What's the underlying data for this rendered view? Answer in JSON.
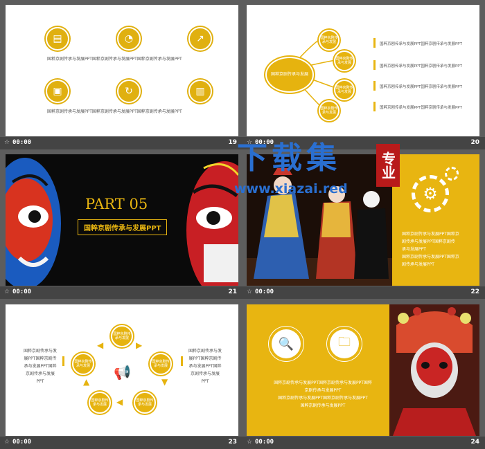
{
  "slides": [
    {
      "num": "19",
      "time": "00:00",
      "caption1": "国粹京剧传承与发展PPT国粹京剧传承与发展PPT国粹京剧传承与发展PPT",
      "caption2": "国粹京剧传承与发展PPT国粹京剧传承与发展PPT国粹京剧传承与发展PPT"
    },
    {
      "num": "20",
      "time": "00:00",
      "center": "国粹京剧传承与发展",
      "nodes": [
        "国粹京剧传承与发展",
        "国粹京剧传承与发展",
        "国粹京剧传承与发展",
        "国粹京剧传承与发展"
      ],
      "items": [
        "国粹京剧传承与发展PPT国粹京剧传承与发展PPT",
        "国粹京剧传承与发展PPT国粹京剧传承与发展PPT",
        "国粹京剧传承与发展PPT国粹京剧传承与发展PPT",
        "国粹京剧传承与发展PPT国粹京剧传承与发展PPT"
      ]
    },
    {
      "num": "21",
      "time": "00:00",
      "part": "PART 05",
      "subtitle": "国粹京剧传承与发展PPT"
    },
    {
      "num": "22",
      "time": "00:00",
      "text": [
        "国粹京剧传承与发展PPT国粹京",
        "剧传承与发展PPT国粹京剧传",
        "承与发展PPT",
        "国粹京剧传承与发展PPT国粹京",
        "剧传承与发展PPT"
      ]
    },
    {
      "num": "23",
      "time": "00:00",
      "left": [
        "国粹京剧传承与发",
        "展PPT国粹京剧传",
        "承与发展PPT国粹",
        "京剧传承与发展",
        "PPT"
      ],
      "right": [
        "国粹京剧传承与发",
        "展PPT国粹京剧传",
        "承与发展PPT国粹",
        "京剧传承与发展",
        "PPT"
      ],
      "cycle": [
        "国粹京剧传承与发展",
        "国粹京剧传承与发展",
        "国粹京剧传承与发展",
        "国粹京剧传承与发展",
        "国粹京剧传承与发展"
      ]
    },
    {
      "num": "24",
      "time": "00:00",
      "text": [
        "国粹京剧传承与发展PPT国粹京剧传承与发展PPT国粹",
        "京剧传承与发展PPT",
        "国粹京剧传承与发展PPT国粹京剧传承与发展PPT",
        "国粹京剧传承与发展PPT"
      ]
    }
  ],
  "watermark": {
    "title": "下载集",
    "badge": "专业",
    "url": "www.xiazai.red"
  },
  "colors": {
    "accent": "#e8b511",
    "dark": "#444444"
  }
}
